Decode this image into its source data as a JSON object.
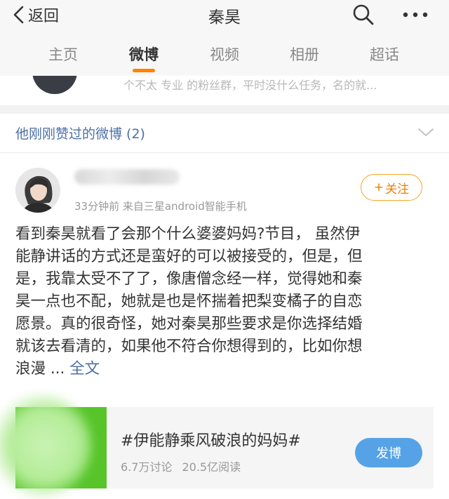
{
  "navbar": {
    "back_label": "返回",
    "title": "秦昊",
    "back_icon": "chevron-left-icon",
    "search_icon": "search-icon",
    "more_icon": "more-horizontal-icon"
  },
  "tabs": [
    {
      "label": "主页",
      "active": false
    },
    {
      "label": "微博",
      "active": true
    },
    {
      "label": "视频",
      "active": false
    },
    {
      "label": "相册",
      "active": false
    },
    {
      "label": "超话",
      "active": false
    }
  ],
  "accent_color": "#ff8200",
  "peek": {
    "text": "个不太 专业 的粉丝群，平时没什么任务，名的就..."
  },
  "section": {
    "title": "他刚刚赞过的微博 (2)",
    "chevron_icon": "chevron-down-icon"
  },
  "post": {
    "meta": "33分钟前  来自三星android智能手机",
    "follow_label": "关注",
    "content_lines": [
      "看到秦昊就看了会那个什么婆婆妈妈?节目， 虽然伊",
      "能静讲话的方式还是蛮好的可以被接受的，但是，但",
      "是，我靠太受不了了，像唐僧念经一样，觉得她和秦",
      "昊一点也不配，她就是也是怀揣着把梨变橘子的自恋",
      "愿景。真的很奇怪，她对秦昊那些要求是你选择结婚",
      "就该去看清的，如果他不符合你想得到的，比如你想"
    ],
    "last_line": "浪漫 ... ",
    "fulltext_label": "全文"
  },
  "topic": {
    "title": "#伊能静乘风破浪的妈妈#",
    "discussions": "6.7万讨论",
    "reads": "20.5亿阅读",
    "post_button": "发博"
  }
}
